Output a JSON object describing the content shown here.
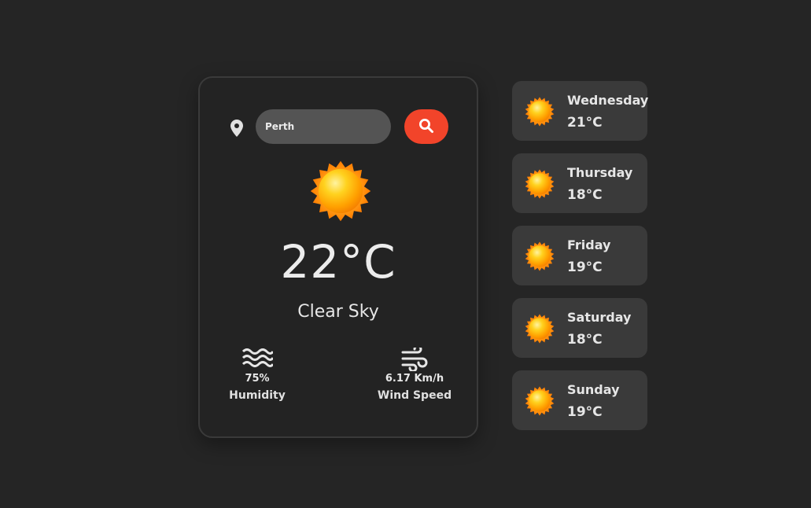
{
  "search": {
    "value": "Perth"
  },
  "current": {
    "icon": "sun-icon",
    "temperature": "22°C",
    "description": "Clear Sky",
    "humidity": {
      "icon": "waves-icon",
      "value": "75%",
      "label": "Humidity"
    },
    "wind": {
      "icon": "wind-icon",
      "value": "6.17 Km/h",
      "label": "Wind Speed"
    }
  },
  "forecast": [
    {
      "day": "Wednesday",
      "temp": "21°C",
      "icon": "sun-icon"
    },
    {
      "day": "Thursday",
      "temp": "18°C",
      "icon": "sun-icon"
    },
    {
      "day": "Friday",
      "temp": "19°C",
      "icon": "sun-icon"
    },
    {
      "day": "Saturday",
      "temp": "18°C",
      "icon": "sun-icon"
    },
    {
      "day": "Sunday",
      "temp": "19°C",
      "icon": "sun-icon"
    }
  ],
  "colors": {
    "background": "#252525",
    "card": "#232323",
    "forecast_card": "#3a3a3a",
    "input": "#545454",
    "accent": "#f2442a",
    "sun": "#ffb300"
  }
}
